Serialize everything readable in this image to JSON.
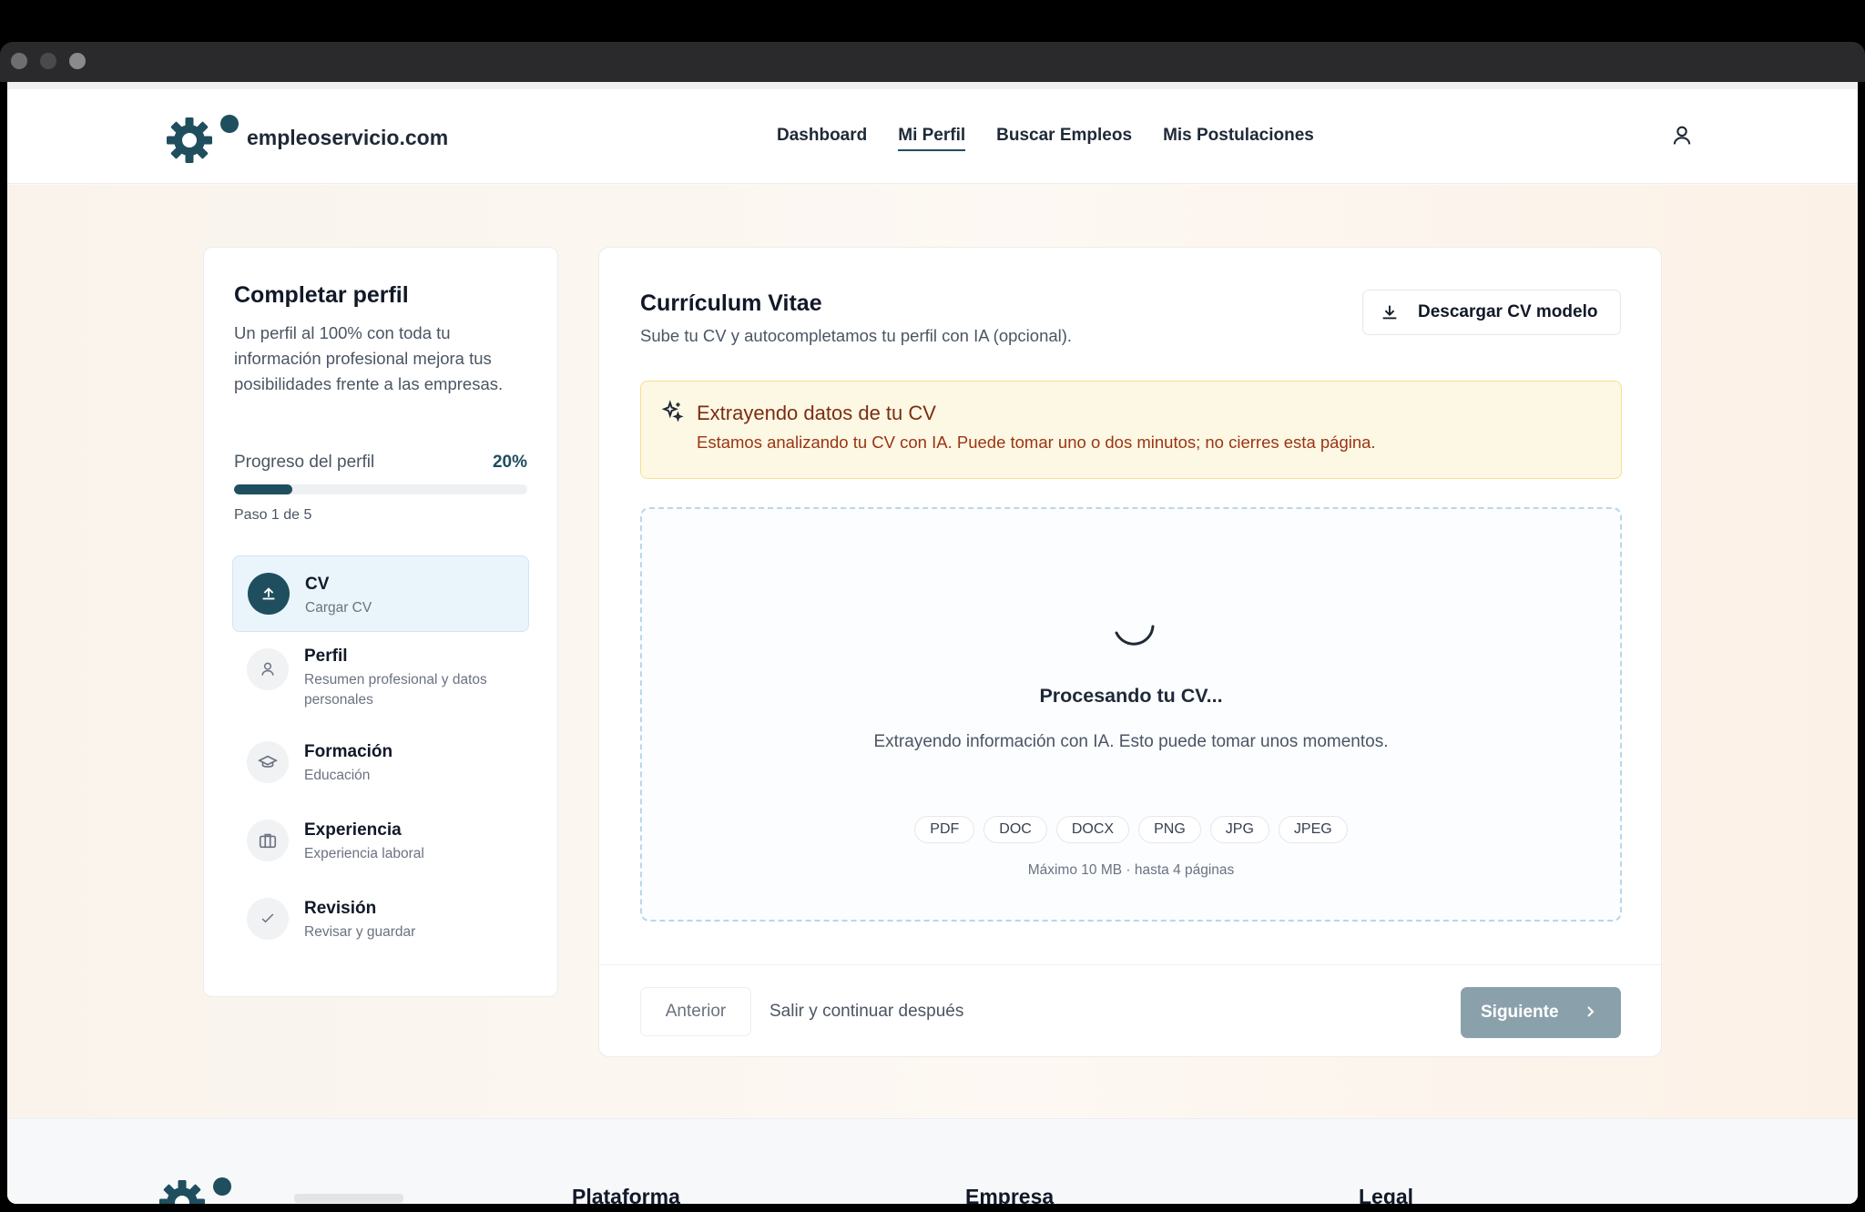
{
  "app": {
    "brand": "empleoservicio.com",
    "accent": "#1f4e5f"
  },
  "nav": {
    "items": [
      {
        "label": "Dashboard",
        "active": false
      },
      {
        "label": "Mi Perfil",
        "active": true
      },
      {
        "label": "Buscar Empleos",
        "active": false
      },
      {
        "label": "Mis Postulaciones",
        "active": false
      }
    ],
    "user_icon": "user-icon"
  },
  "sidebar": {
    "title": "Completar perfil",
    "description": "Un perfil al 100% con toda tu información profesional mejora tus posibilidades frente a las empresas.",
    "progress_label": "Progreso del perfil",
    "progress_percent": "20%",
    "progress_value": 0.2,
    "step_count": "Paso 1 de 5",
    "steps": [
      {
        "title": "CV",
        "subtitle": "Cargar CV",
        "icon": "upload-icon",
        "active": true
      },
      {
        "title": "Perfil",
        "subtitle": "Resumen profesional y datos personales",
        "icon": "user-icon",
        "active": false
      },
      {
        "title": "Formación",
        "subtitle": "Educación",
        "icon": "graduation-cap-icon",
        "active": false
      },
      {
        "title": "Experiencia",
        "subtitle": "Experiencia laboral",
        "icon": "briefcase-icon",
        "active": false
      },
      {
        "title": "Revisión",
        "subtitle": "Revisar y guardar",
        "icon": "check-icon",
        "active": false
      }
    ]
  },
  "main": {
    "title": "Currículum Vitae",
    "subtitle": "Sube tu CV y autocompletamos tu perfil con IA (opcional).",
    "download_label": "Descargar CV modelo",
    "alert": {
      "title": "Extrayendo datos de tu CV",
      "message": "Estamos analizando tu CV con IA. Puede tomar uno o dos minutos; no cierres esta página."
    },
    "dropzone": {
      "processing_title": "Procesando tu CV...",
      "processing_message": "Extrayendo información con IA. Esto puede tomar unos momentos.",
      "formats": [
        "PDF",
        "DOC",
        "DOCX",
        "PNG",
        "JPG",
        "JPEG"
      ],
      "limits": "Máximo 10 MB · hasta 4 páginas"
    },
    "footer": {
      "prev_label": "Anterior",
      "exit_label": "Salir y continuar después",
      "next_label": "Siguiente"
    }
  },
  "site_footer": {
    "columns": [
      "Plataforma",
      "Empresa",
      "Legal"
    ]
  }
}
